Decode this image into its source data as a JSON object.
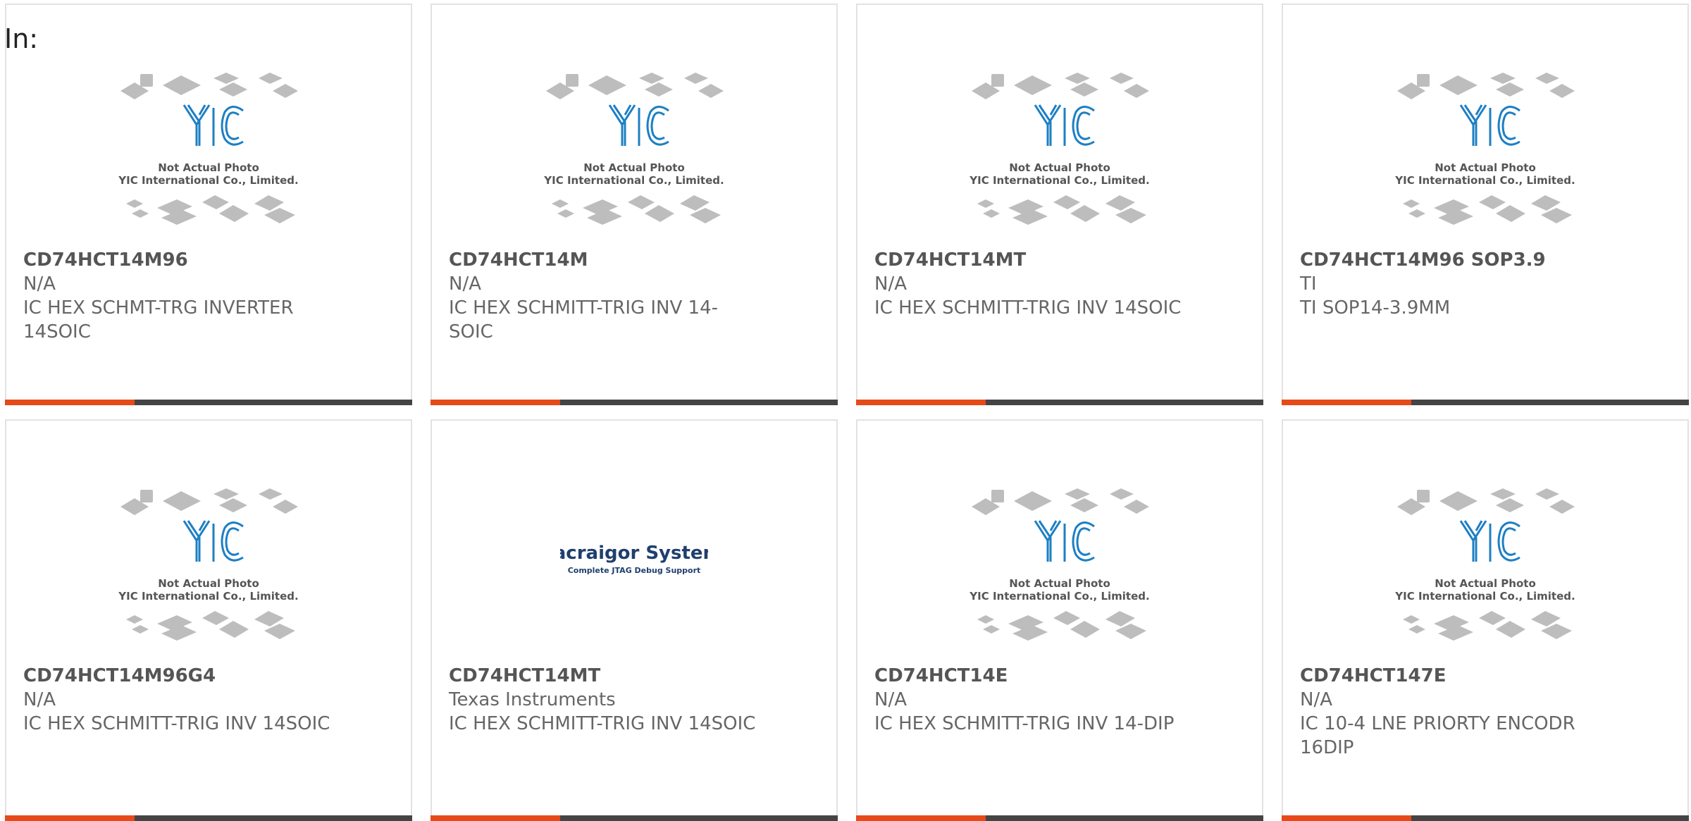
{
  "header": {
    "label": "In:"
  },
  "placeholder_image": {
    "line1": "Not Actual Photo",
    "line2": "YIC International Co., Limited.",
    "logo_text": "YIC"
  },
  "macraigor_image": {
    "title": "Macraigor Systems",
    "tagline": "Complete JTAG Debug Support"
  },
  "colors": {
    "accent": "#e64a19",
    "bar": "#444444",
    "logo_blue": "#1d7fc4",
    "macraigor_blue": "#1f3f6e"
  },
  "products": [
    {
      "part": "CD74HCT14M96",
      "manufacturer": "N/A",
      "description": "IC HEX SCHMT-TRG INVERTER 14SOIC",
      "image": "yic-placeholder"
    },
    {
      "part": "CD74HCT14M",
      "manufacturer": "N/A",
      "description": "IC HEX SCHMITT-TRIG INV 14-SOIC",
      "image": "yic-placeholder"
    },
    {
      "part": "CD74HCT14MT",
      "manufacturer": "N/A",
      "description": "IC HEX SCHMITT-TRIG INV 14SOIC",
      "image": "yic-placeholder"
    },
    {
      "part": "CD74HCT14M96 SOP3.9",
      "manufacturer": "TI",
      "description": "TI SOP14-3.9MM",
      "image": "yic-placeholder"
    },
    {
      "part": "CD74HCT14M96G4",
      "manufacturer": "N/A",
      "description": "IC HEX SCHMITT-TRIG INV 14SOIC",
      "image": "yic-placeholder"
    },
    {
      "part": "CD74HCT14MT",
      "manufacturer": "Texas Instruments",
      "description": "IC HEX SCHMITT-TRIG INV 14SOIC",
      "image": "macraigor-logo"
    },
    {
      "part": "CD74HCT14E",
      "manufacturer": "N/A",
      "description": "IC HEX SCHMITT-TRIG INV 14-DIP",
      "image": "yic-placeholder"
    },
    {
      "part": "CD74HCT147E",
      "manufacturer": "N/A",
      "description": "IC 10-4 LNE PRIORTY ENCODR 16DIP",
      "image": "yic-placeholder"
    }
  ]
}
